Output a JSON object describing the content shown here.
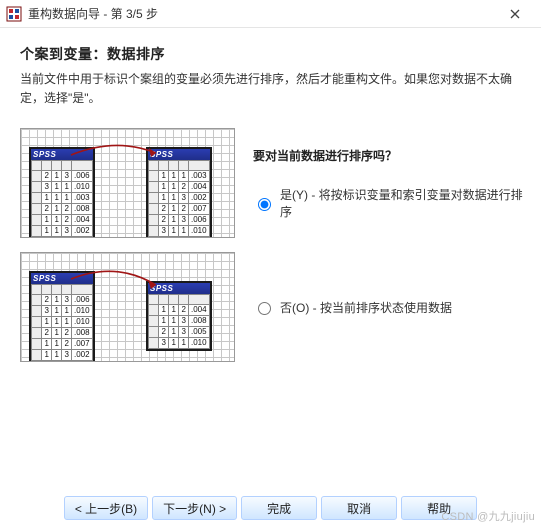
{
  "window": {
    "title": "重构数据向导 - 第 3/5 步"
  },
  "page": {
    "heading": "个案到变量：数据排序",
    "description": "当前文件中用于标识个案组的变量必须先进行排序，然后才能重构文件。如果您对数据不太确定，选择\"是\"。"
  },
  "prompt": "要对当前数据进行排序吗？",
  "options": {
    "yes_label": "是(Y) - 将按标识变量和索引变量对数据进行排序",
    "no_label": "否(O) - 按当前排序状态使用数据",
    "selected": "yes"
  },
  "illustration": {
    "spss_label": "SPSS",
    "yes": {
      "left_rows": [
        [
          "2",
          "1",
          "3",
          ".006"
        ],
        [
          "3",
          "1",
          "1",
          ".010"
        ],
        [
          "1",
          "1",
          "1",
          ".003"
        ],
        [
          "2",
          "1",
          "2",
          ".008"
        ],
        [
          "1",
          "1",
          "2",
          ".004"
        ],
        [
          "1",
          "1",
          "3",
          ".002"
        ]
      ],
      "right_rows": [
        [
          "1",
          "1",
          "1",
          ".003"
        ],
        [
          "1",
          "1",
          "2",
          ".004"
        ],
        [
          "1",
          "1",
          "3",
          ".002"
        ],
        [
          "2",
          "1",
          "2",
          ".007"
        ],
        [
          "2",
          "1",
          "3",
          ".006"
        ],
        [
          "3",
          "1",
          "1",
          ".010"
        ]
      ]
    },
    "no": {
      "left_rows": [
        [
          "2",
          "1",
          "3",
          ".006"
        ],
        [
          "3",
          "1",
          "1",
          ".010"
        ],
        [
          "1",
          "1",
          "1",
          ".010"
        ],
        [
          "2",
          "1",
          "2",
          ".008"
        ],
        [
          "1",
          "1",
          "2",
          ".007"
        ],
        [
          "1",
          "1",
          "3",
          ".002"
        ]
      ],
      "right_rows": [
        [
          "1",
          "1",
          "2",
          ".004"
        ],
        [
          "1",
          "1",
          "3",
          ".008"
        ],
        [
          "2",
          "1",
          "3",
          ".005"
        ],
        [
          "3",
          "1",
          "1",
          ".010"
        ]
      ]
    }
  },
  "buttons": {
    "back": "< 上一步(B)",
    "next": "下一步(N) >",
    "finish": "完成",
    "cancel": "取消",
    "help": "帮助"
  },
  "watermark": "CSDN @九九jiujiu"
}
